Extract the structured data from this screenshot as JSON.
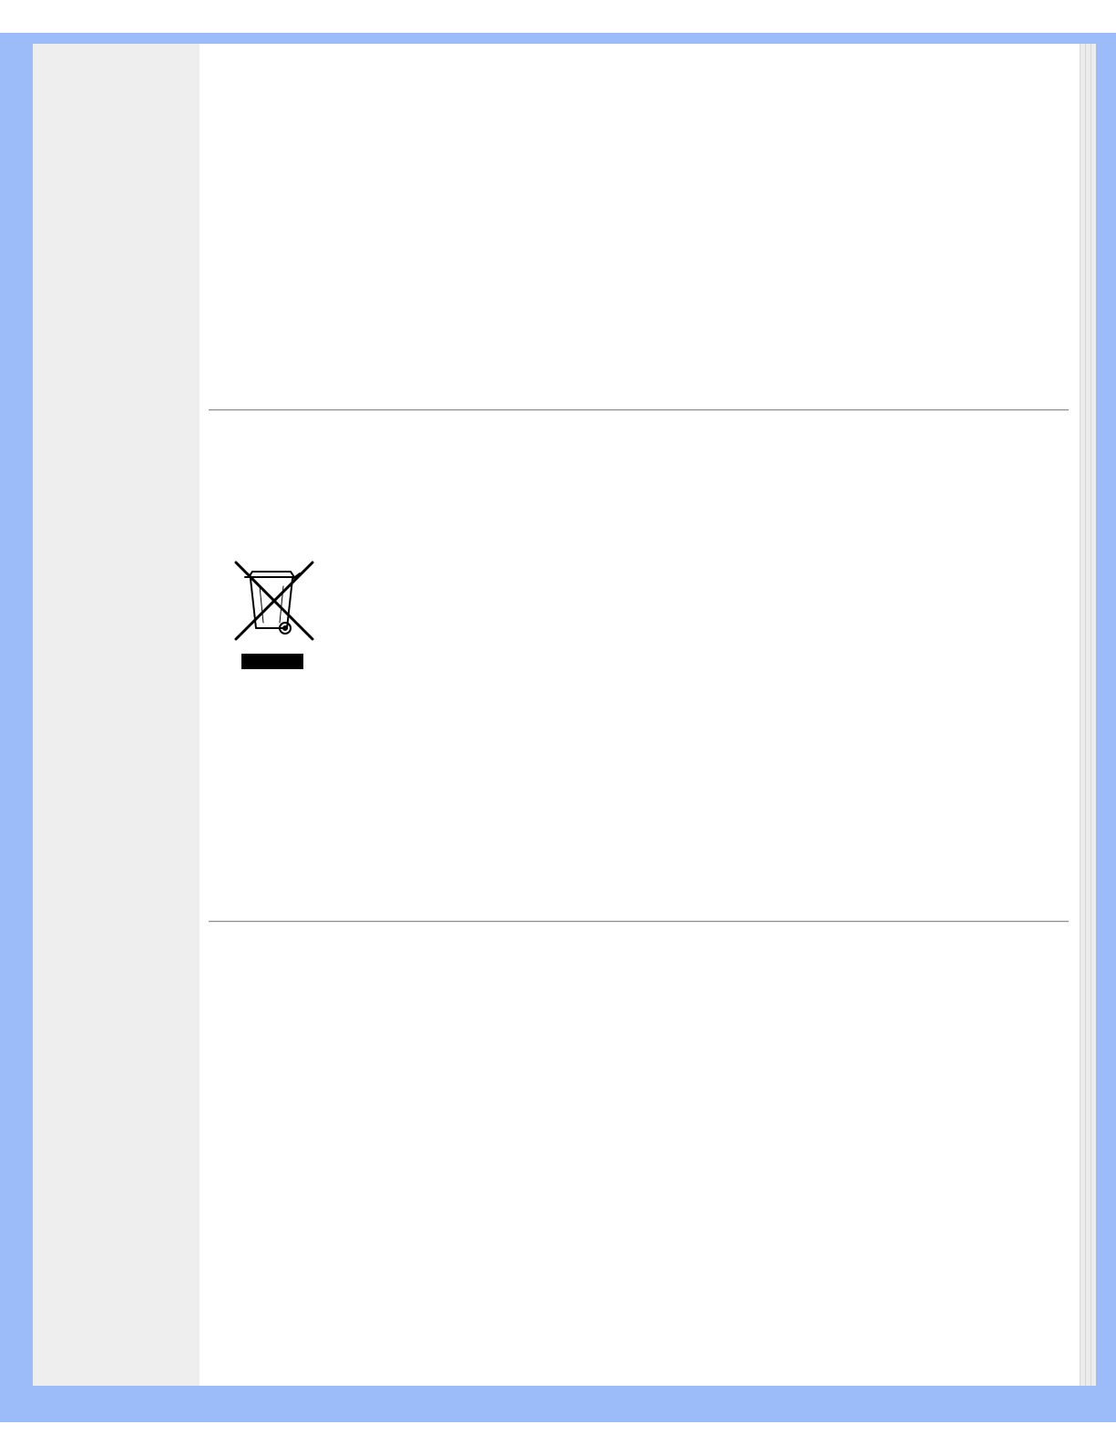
{
  "colors": {
    "frame": "#9bbcf8",
    "sidebar": "#eeeeee",
    "content": "#ffffff",
    "rule": "#8c8c8c"
  },
  "icons": {
    "weee_symbol": "crossed-out-wheelie-bin-icon"
  }
}
